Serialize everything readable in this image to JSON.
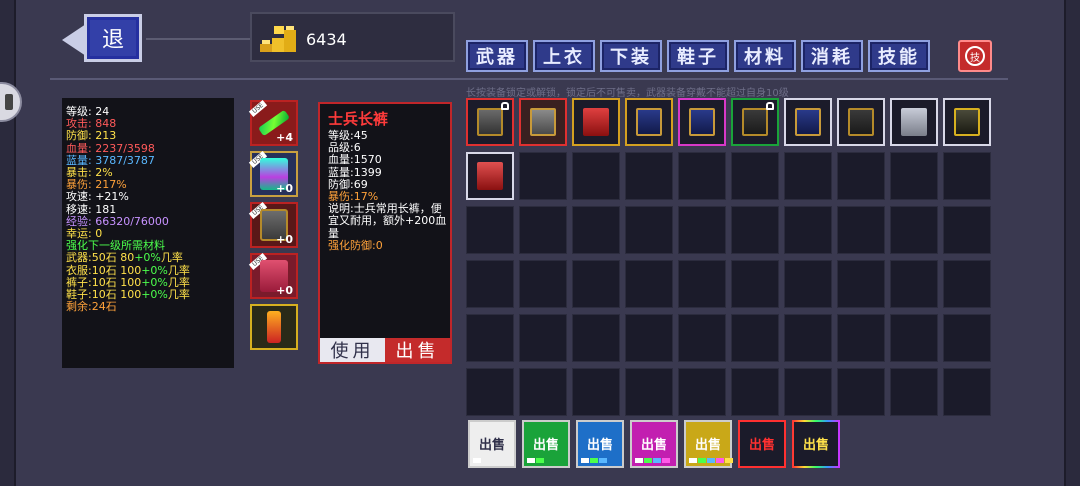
{
  "back_label": "退",
  "gold": {
    "amount": "6434",
    "icon": "gold-coins-icon"
  },
  "tabs": [
    "武器",
    "上衣",
    "下装",
    "鞋子",
    "材料",
    "消耗",
    "技能"
  ],
  "close_icon_label": "技",
  "hint": "长按装备锁定或解锁，锁定后不可售卖，武器装备穿戴不能超过自身10级",
  "stats": {
    "level": "等级: 24",
    "attack": "攻击: 848",
    "defense": "防御: 213",
    "hp": "血量: 2237/3598",
    "mp": "蓝量: 3787/3787",
    "crit": "暴击: 2%",
    "crit_dmg": "暴伤: 217%",
    "atk_speed": "攻速: +21%",
    "move_speed": "移速: 181",
    "exp": "经验: 66320/76000",
    "luck": "幸运: 0",
    "enhance_title": "强化下一级所需材料",
    "weapon": {
      "label": "武器:50石 80",
      "bonus": "+0%",
      "rate": "几率"
    },
    "clothes": {
      "label": "衣服:10石 100",
      "bonus": "+0%",
      "rate": "几率"
    },
    "pants": {
      "label": "裤子:10石 100",
      "bonus": "+0%",
      "rate": "几率"
    },
    "shoes": {
      "label": "鞋子:10石 100",
      "bonus": "+0%",
      "rate": "几率"
    },
    "remaining": "剩余:24石"
  },
  "equipped": [
    {
      "name": "weapon-slot",
      "plus": "+4",
      "tag": "USE"
    },
    {
      "name": "armor-slot",
      "plus": "+0",
      "tag": "USE"
    },
    {
      "name": "pants-slot",
      "plus": "+0",
      "tag": "USE"
    },
    {
      "name": "boots-slot",
      "plus": "+0",
      "tag": "USE"
    },
    {
      "name": "accessory-slot",
      "plus": "",
      "tag": ""
    }
  ],
  "detail": {
    "name": "士兵长裤",
    "level": "等级:45",
    "grade": "品级:6",
    "hp": "血量:1570",
    "mp": "蓝量:1399",
    "def": "防御:69",
    "crit_dmg": "暴伤:17%",
    "desc": "说明:士兵常用长裤，便宜又耐用，额外+200血量",
    "enhance": "强化防御:0",
    "use_btn": "使用",
    "sell_btn": "出售"
  },
  "sell_buttons": [
    {
      "label": "出售",
      "bg": "#eeeeee",
      "fg": "#30304a",
      "dots": [
        "#ffffff"
      ]
    },
    {
      "label": "出售",
      "bg": "#1aa33a",
      "fg": "#ffffff",
      "dots": [
        "#ffffff",
        "#4cff4c"
      ]
    },
    {
      "label": "出售",
      "bg": "#1e6fc8",
      "fg": "#ffffff",
      "dots": [
        "#ffffff",
        "#4cff4c",
        "#5ab8ff"
      ]
    },
    {
      "label": "出售",
      "bg": "#c21fb0",
      "fg": "#ffffff",
      "dots": [
        "#ffffff",
        "#4cff4c",
        "#5ab8ff",
        "#ff5ae8"
      ]
    },
    {
      "label": "出售",
      "bg": "#c9a818",
      "fg": "#ffffff",
      "dots": [
        "#ffffff",
        "#4cff4c",
        "#5ab8ff",
        "#ff5ae8",
        "#ffe14a"
      ]
    },
    {
      "label": "出售",
      "bg": "#1b1b2a",
      "fg": "#ff3030",
      "dots": []
    },
    {
      "label": "出售",
      "bg": "#1b1b2a",
      "fg": "#ffe14a",
      "dots": []
    }
  ],
  "inventory_count": 60
}
